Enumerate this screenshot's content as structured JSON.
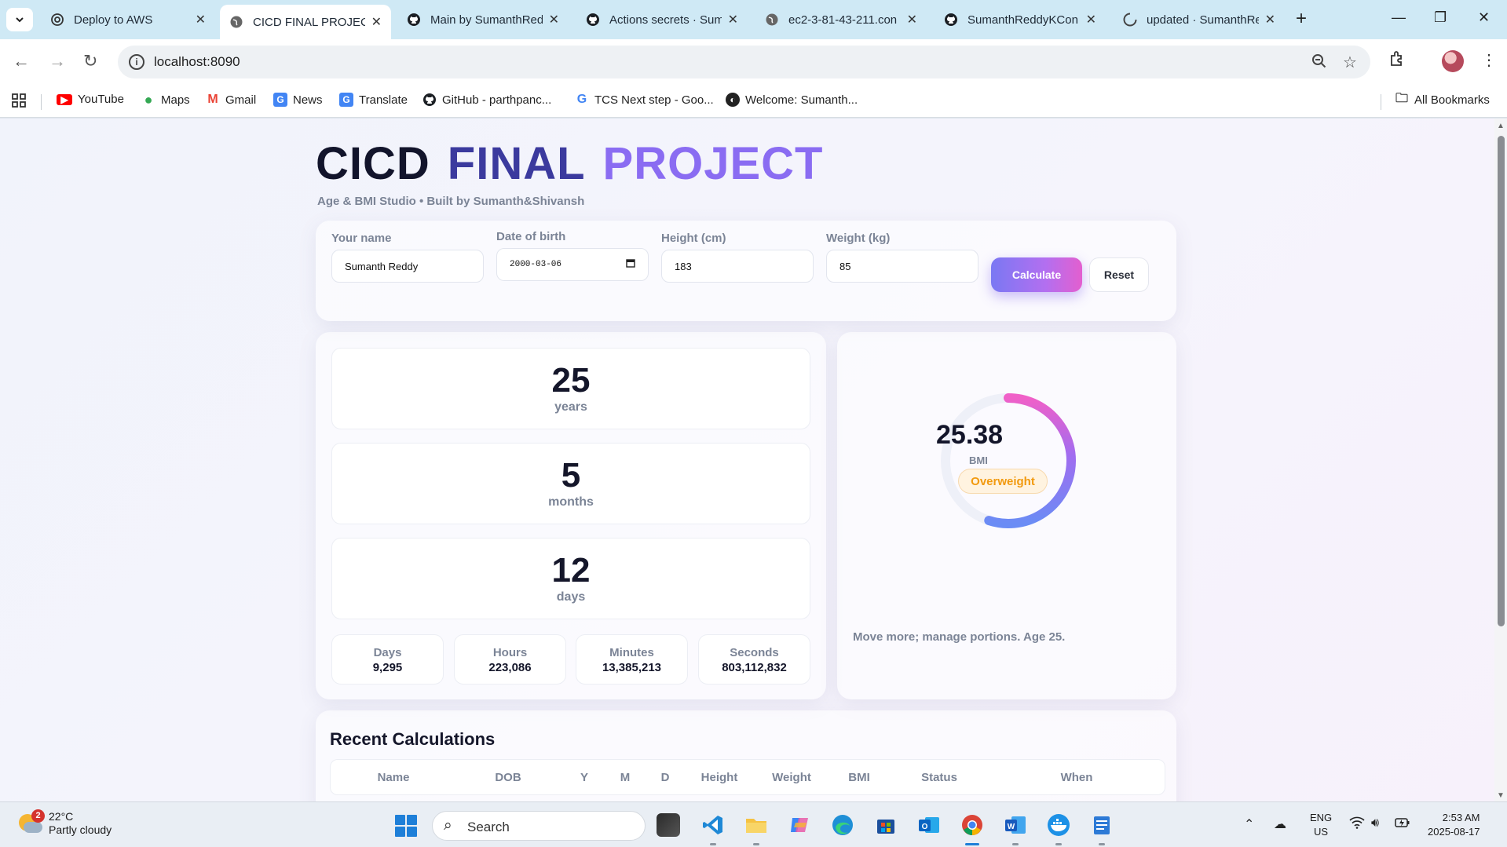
{
  "browser": {
    "tabs": [
      {
        "title": "Deploy to AWS",
        "icon": "openai-icon"
      },
      {
        "title": "CICD FINAL PROJECT",
        "icon": "globe-icon"
      },
      {
        "title": "Main by SumanthRed",
        "icon": "github-icon"
      },
      {
        "title": "Actions secrets · Sum",
        "icon": "github-icon"
      },
      {
        "title": "ec2-3-81-43-211.con",
        "icon": "globe-icon"
      },
      {
        "title": "SumanthReddyKCon",
        "icon": "github-icon"
      },
      {
        "title": "updated · SumanthRe",
        "icon": "github-loading-icon"
      }
    ],
    "new_tab": "+",
    "url": "localhost:8090",
    "bookmarks": [
      {
        "label": "YouTube",
        "icon": "youtube-icon",
        "color": "#ff0000"
      },
      {
        "label": "Maps",
        "icon": "maps-icon",
        "color": "#34a853"
      },
      {
        "label": "Gmail",
        "icon": "gmail-icon",
        "color": "#ea4335"
      },
      {
        "label": "News",
        "icon": "news-icon",
        "color": "#4285f4"
      },
      {
        "label": "Translate",
        "icon": "translate-icon",
        "color": "#4285f4"
      },
      {
        "label": "GitHub - parthpanc...",
        "icon": "github-icon",
        "color": "#111111"
      },
      {
        "label": "TCS Next step - Goo...",
        "icon": "google-icon",
        "color": "#4285f4"
      },
      {
        "label": "Welcome: Sumanth...",
        "icon": "globe-dark-icon",
        "color": "#222222"
      }
    ],
    "all_bookmarks": "All Bookmarks"
  },
  "app": {
    "title_words": [
      "CICD",
      "FINAL",
      "PROJECT"
    ],
    "subtitle": "Age & BMI Studio • Built by Sumanth&Shivansh",
    "form": {
      "name_label": "Your name",
      "name_value": "Sumanth Reddy",
      "dob_label": "Date of birth",
      "dob_value": "2000-03-06",
      "height_label": "Height (cm)",
      "height_value": "183",
      "weight_label": "Weight (kg)",
      "weight_value": "85",
      "calculate": "Calculate",
      "reset": "Reset"
    },
    "age": {
      "years": "25",
      "years_label": "years",
      "months": "5",
      "months_label": "months",
      "days": "12",
      "days_label": "days",
      "totals": [
        {
          "label": "Days",
          "value": "9,295"
        },
        {
          "label": "Hours",
          "value": "223,086"
        },
        {
          "label": "Minutes",
          "value": "13,385,213"
        },
        {
          "label": "Seconds",
          "value": "803,112,832"
        }
      ]
    },
    "bmi": {
      "value": "25.38",
      "label": "BMI",
      "status": "Overweight",
      "gauge_fraction": 0.55,
      "advice": "Move more; manage portions. Age 25.",
      "colors": {
        "gauge_start": "#6a8cf5",
        "gauge_mid": "#a26cf0",
        "gauge_end": "#f060c8",
        "status": "#f29a0f"
      }
    },
    "recent": {
      "title": "Recent Calculations",
      "columns": [
        "Name",
        "DOB",
        "Y",
        "M",
        "D",
        "Height",
        "Weight",
        "BMI",
        "Status",
        "When"
      ]
    },
    "accent_colors": {
      "title_dark": "#12142b",
      "title_mid": "#3b3a9e",
      "title_light": "#8a6cf2",
      "button_from": "#7a78f3",
      "button_to": "#e35fcf"
    }
  },
  "taskbar": {
    "weather_temp": "22°C",
    "weather_desc": "Partly cloudy",
    "weather_badge": "2",
    "search_placeholder": "Search",
    "apps": [
      "file-explorer-icon",
      "vscode-icon",
      "folder-icon",
      "copilot-icon",
      "edge-icon",
      "store-icon",
      "outlook-icon",
      "chrome-icon",
      "word-icon",
      "docker-icon",
      "notepad-icon"
    ],
    "lang_1": "ENG",
    "lang_2": "US",
    "time": "2:53 AM",
    "date": "2025-08-17"
  }
}
